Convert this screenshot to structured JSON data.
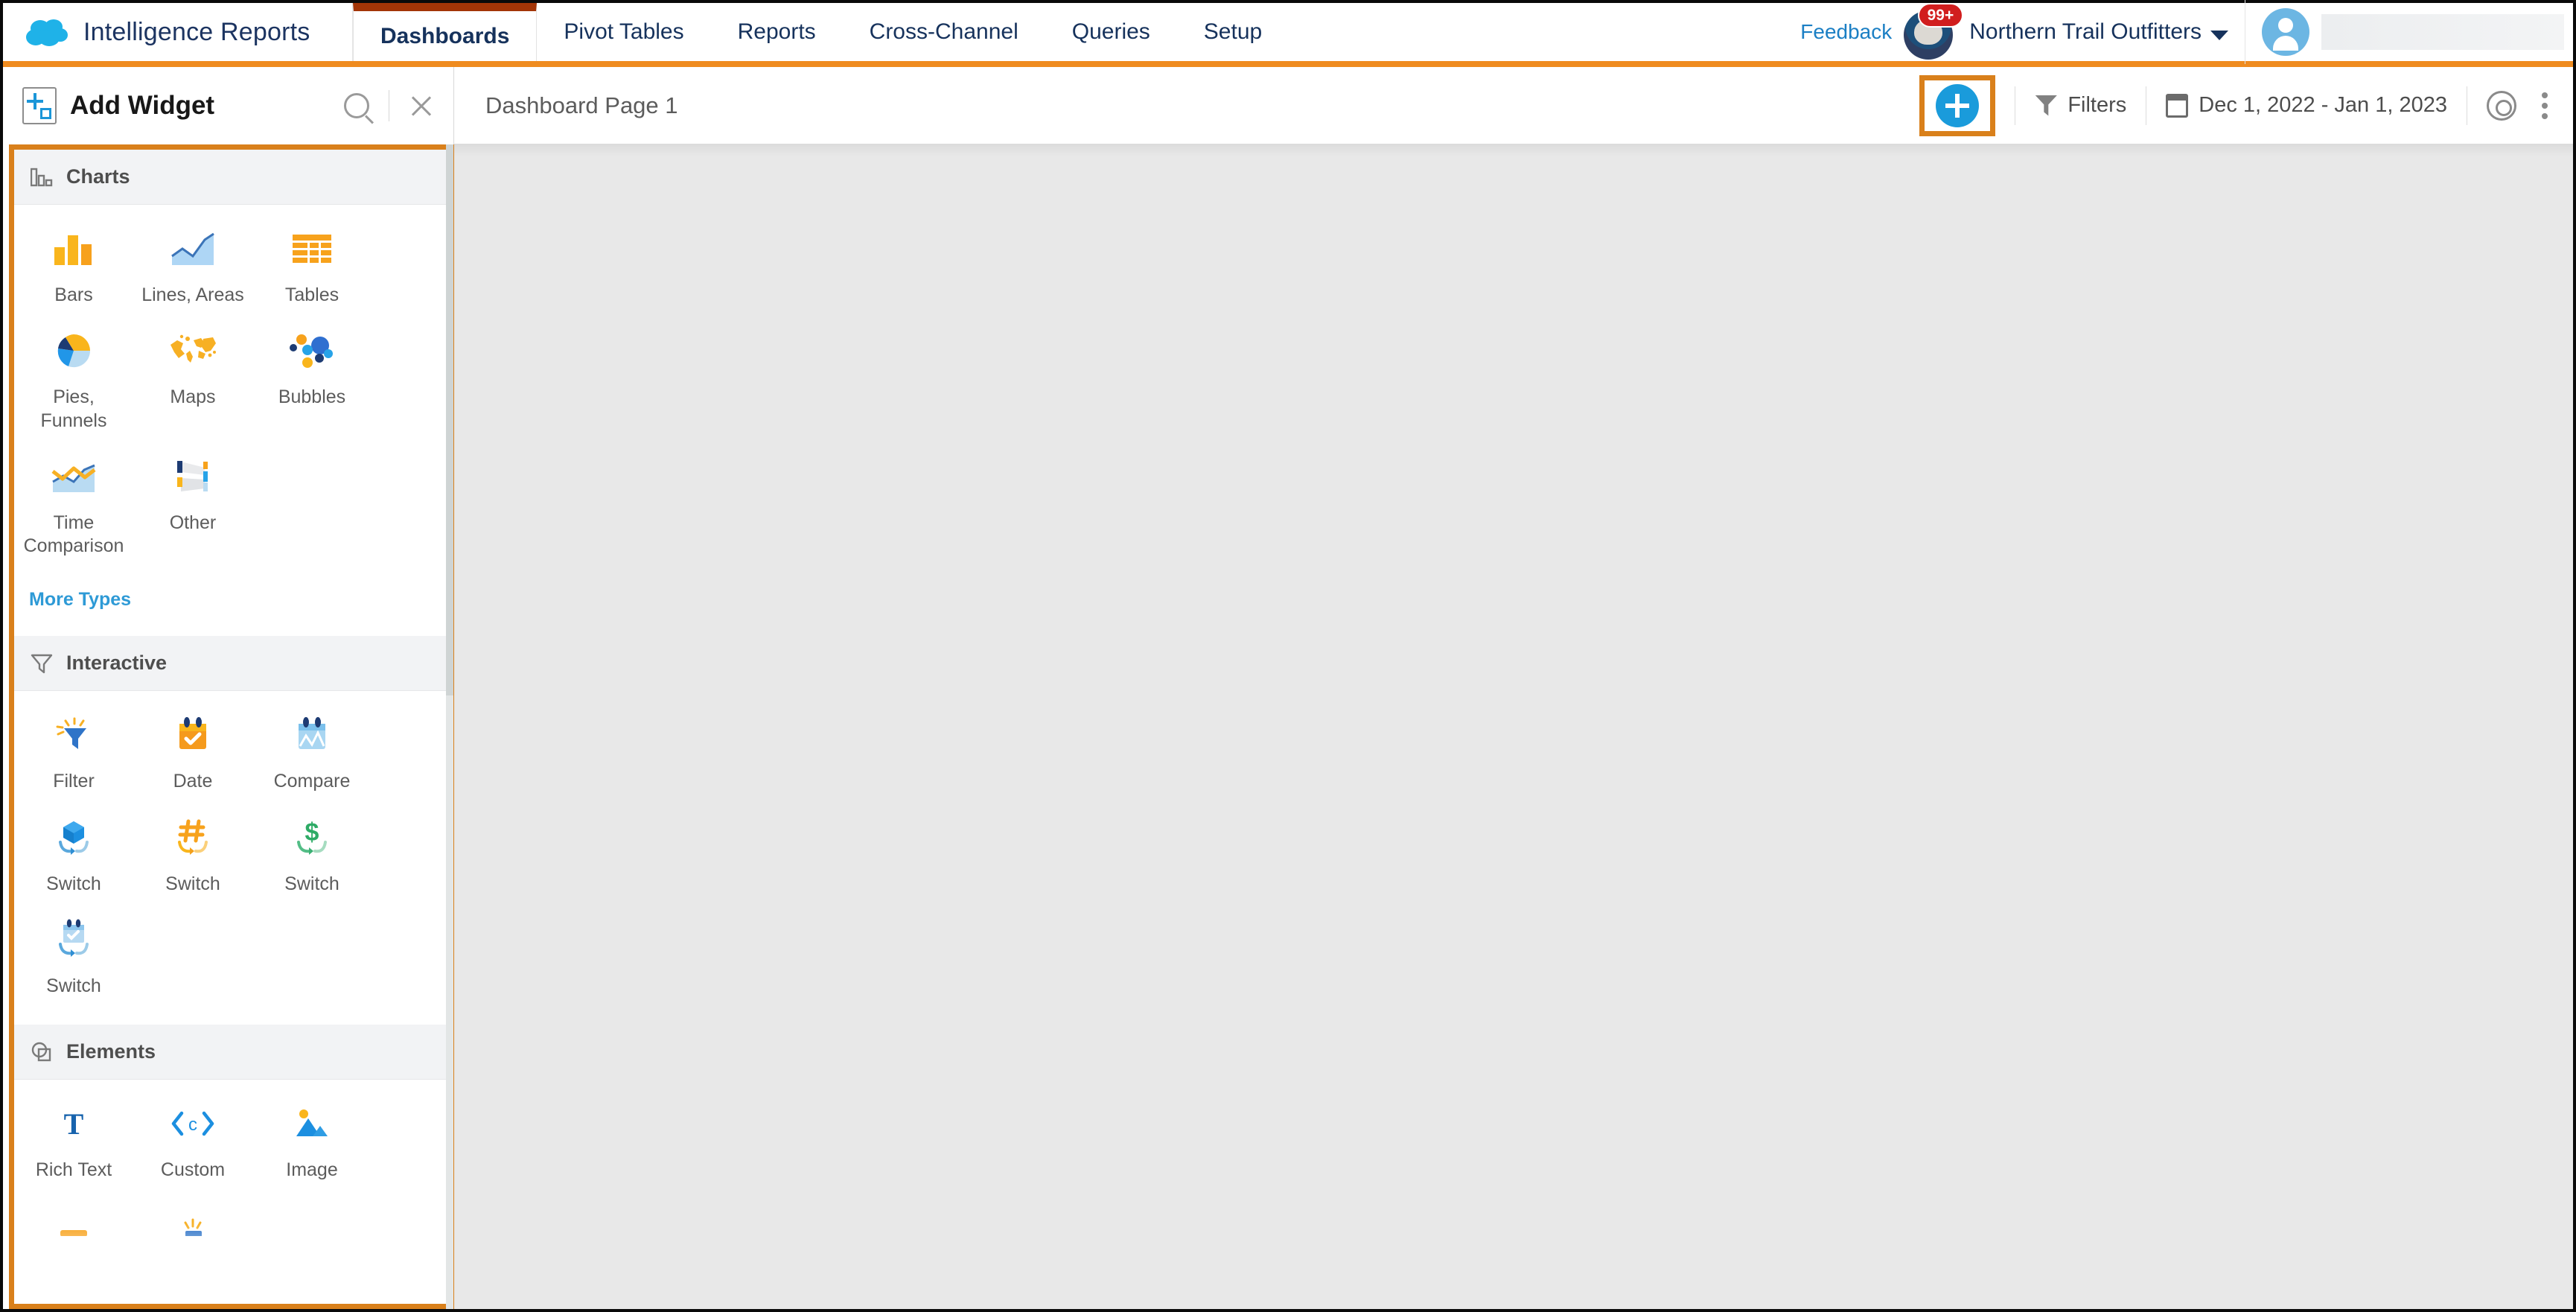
{
  "topnav": {
    "brand": "Intelligence Reports",
    "logo_icon": "salesforce-cloud-icon",
    "tabs": [
      {
        "label": "Dashboards",
        "active": true
      },
      {
        "label": "Pivot Tables",
        "active": false
      },
      {
        "label": "Reports",
        "active": false
      },
      {
        "label": "Cross-Channel",
        "active": false
      },
      {
        "label": "Queries",
        "active": false
      },
      {
        "label": "Setup",
        "active": false
      }
    ],
    "feedback_label": "Feedback",
    "notification_badge": "99+",
    "org_name": "Northern Trail Outfitters",
    "org_caret_icon": "chevron-down-icon",
    "user_avatar_icon": "person-avatar-icon",
    "active_tab_border_color": "#a33507",
    "brand_bar_color": "#ef8b1f"
  },
  "panel": {
    "title": "Add Widget",
    "title_icon": "add-widget-icon",
    "search_icon": "search-icon",
    "close_icon": "close-icon",
    "highlight_color": "#d9801b",
    "sections": [
      {
        "name": "Charts",
        "icon": "bar-chart-icon",
        "more_types_label": "More Types",
        "items": [
          {
            "label": "Bars",
            "icon": "bars-widget-icon"
          },
          {
            "label": "Lines, Areas",
            "icon": "lines-areas-widget-icon"
          },
          {
            "label": "Tables",
            "icon": "tables-widget-icon"
          },
          {
            "label": "Pies, Funnels",
            "icon": "pies-funnels-widget-icon"
          },
          {
            "label": "Maps",
            "icon": "maps-widget-icon"
          },
          {
            "label": "Bubbles",
            "icon": "bubbles-widget-icon"
          },
          {
            "label": "Time Comparison",
            "icon": "time-comparison-widget-icon"
          },
          {
            "label": "Other",
            "icon": "other-widget-icon"
          }
        ]
      },
      {
        "name": "Interactive",
        "icon": "funnel-icon",
        "items": [
          {
            "label": "Filter",
            "icon": "filter-widget-icon"
          },
          {
            "label": "Date",
            "icon": "date-widget-icon"
          },
          {
            "label": "Compare",
            "icon": "compare-widget-icon"
          },
          {
            "label": "Switch",
            "icon": "switch-dimension-icon"
          },
          {
            "label": "Switch",
            "icon": "switch-metric-icon"
          },
          {
            "label": "Switch",
            "icon": "switch-currency-icon"
          },
          {
            "label": "Switch",
            "icon": "switch-date-icon"
          }
        ]
      },
      {
        "name": "Elements",
        "icon": "elements-icon",
        "items": [
          {
            "label": "Rich Text",
            "icon": "rich-text-widget-icon"
          },
          {
            "label": "Custom",
            "icon": "custom-code-widget-icon"
          },
          {
            "label": "Image",
            "icon": "image-widget-icon"
          }
        ]
      }
    ]
  },
  "toolbar": {
    "page_title": "Dashboard Page 1",
    "add_widget_button_icon": "plus-circle-icon",
    "filters_label": "Filters",
    "filters_icon": "funnel-icon",
    "date_range": "Dec 1, 2022 - Jan 1, 2023",
    "calendar_icon": "calendar-icon",
    "preview_icon": "eye-icon",
    "more_icon": "kebab-menu-icon",
    "add_button_highlight_color": "#d9801b"
  }
}
